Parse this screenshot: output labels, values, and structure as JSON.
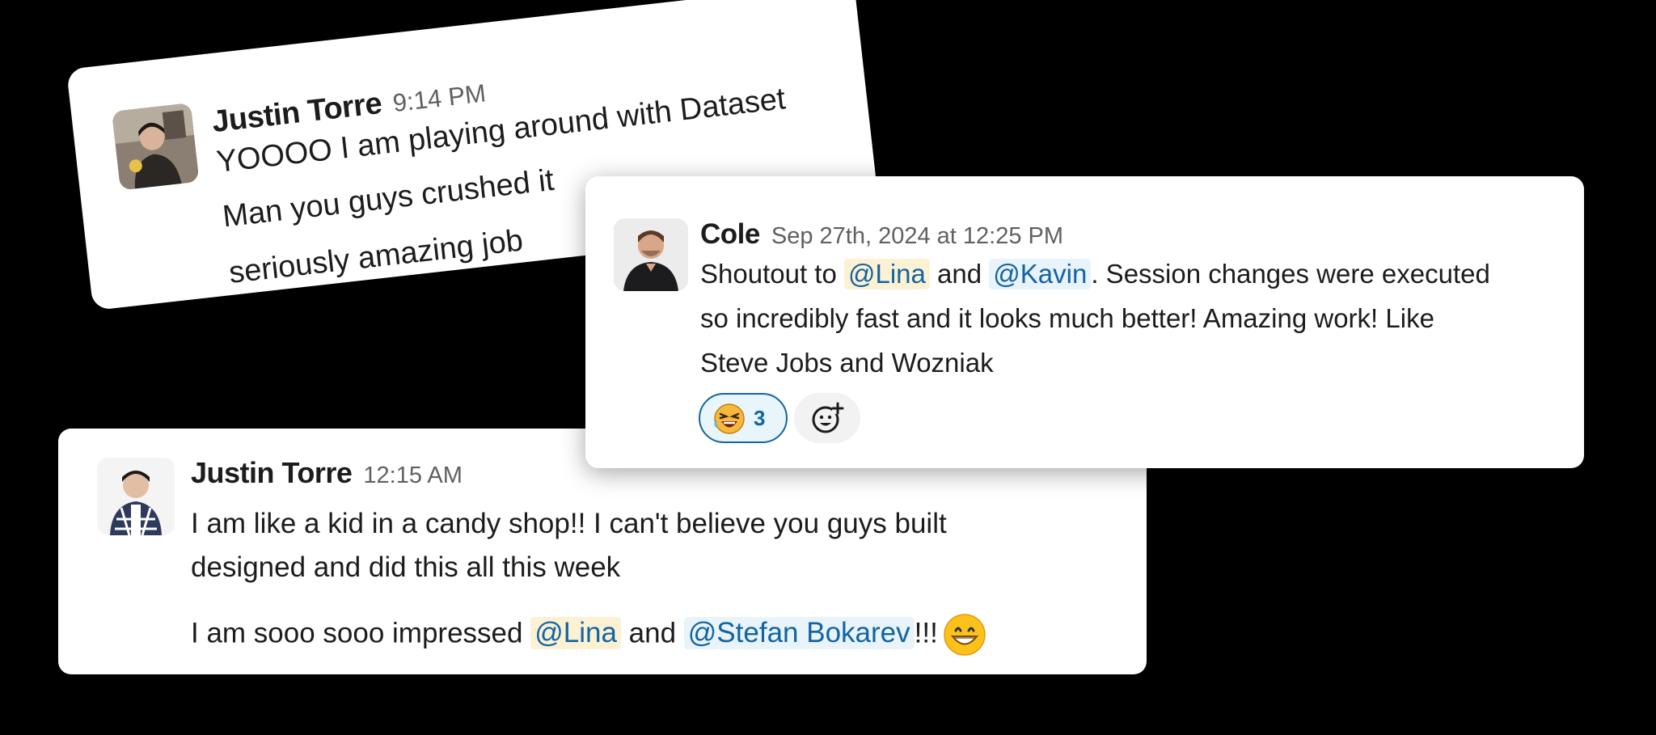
{
  "messages": [
    {
      "author": "Justin Torre",
      "time": "9:14 PM",
      "lines": [
        "YOOOO I am playing around with Dataset",
        "Man you guys crushed it",
        "seriously amazing job"
      ]
    },
    {
      "author": "Cole",
      "time": "Sep 27th, 2024 at 12:25 PM",
      "line1": {
        "pre": "Shoutout to ",
        "mention1": "@Lina",
        "mid": " and ",
        "mention2": "@Kavin",
        "post": ". Session changes were executed"
      },
      "line2": "so incredibly fast and it looks much better! Amazing work! Like",
      "line3": "Steve Jobs and Wozniak",
      "reaction": {
        "emoji": "laughing-face-icon",
        "count": "3"
      }
    },
    {
      "author": "Justin Torre",
      "time": "12:15 AM",
      "line1": "I am like a kid in a candy shop!! I can't believe you guys built",
      "line2": "designed and did this all this week",
      "line3": {
        "pre": "I am sooo sooo impressed ",
        "mention1": "@Lina",
        "mid": " and ",
        "mention2": "@Stefan Bokarev",
        "post": "!!!"
      },
      "emoji": "grinning-face-icon"
    }
  ],
  "colors": {
    "background": "#000000",
    "card": "#ffffff",
    "mention_text": "#1264a3",
    "mention_yellow_bg": "#fdf1d4",
    "mention_blue_bg": "#e8f3fa",
    "timestamp": "#616061"
  }
}
